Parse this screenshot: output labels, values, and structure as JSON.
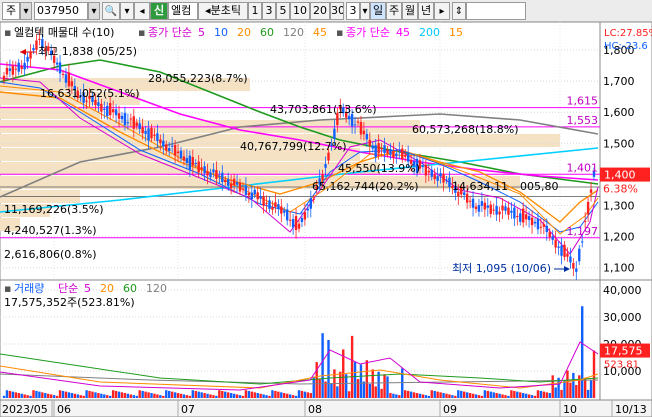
{
  "toolbar": {
    "market": "주",
    "code": "037950",
    "name_tag": "신",
    "name": "엘컴",
    "period_label": "분초틱",
    "periods": [
      "1",
      "3",
      "5",
      "10",
      "20",
      "30"
    ],
    "period_value": "3",
    "tabs": [
      "일",
      "주",
      "월",
      "년"
    ],
    "active_tab": "일"
  },
  "price_pane": {
    "legend_prefix": "엘컴텍 매물대 수(10)",
    "ma_label": "종가 단순",
    "ma_periods": [
      {
        "label": "5",
        "color": "#d100d1"
      },
      {
        "label": "10",
        "color": "#1060ff"
      },
      {
        "label": "20",
        "color": "#ff8c00"
      },
      {
        "label": "60",
        "color": "#1e9a1e"
      },
      {
        "label": "120",
        "color": "#808080"
      },
      {
        "label": "45",
        "color": "#ff8c00"
      }
    ],
    "ma2_label": "종가 단순",
    "ma2_periods": [
      {
        "label": "45",
        "color": "#ff00ff"
      },
      {
        "label": "200",
        "color": "#00c8ff"
      },
      {
        "label": "15",
        "color": "#ff8c00"
      }
    ],
    "lc_label": "LC:27.85%",
    "hc_label": "HC:-23.6",
    "high_label": "최고 1,838 (05/25)",
    "low_label": "최저 1,095 (10/06)",
    "last_price": "1,400",
    "change_pct": "6.38%",
    "h_level_1": "1,615",
    "h_level_2": "1,553",
    "h_level_3": "1,401",
    "h_level_4": "1,197",
    "volume_profile": [
      "28,055,223(8.7%)",
      "16,631,052(5.1%)",
      "43,703,861(13.6%)",
      "60,573,268(18.8%)",
      "40,767,799(12.7%)",
      "45,550(13.9%)",
      "65,162,744(20.2%)",
      "14,634,11",
      "005,80",
      "11,169,226(3.5%)",
      "4,240,527(1.3%)",
      "2,616,806(0.8%)"
    ],
    "y_ticks": [
      "1,800",
      "1,700",
      "1,600",
      "1,500",
      "1,400",
      "1,300",
      "1,200",
      "1,100"
    ]
  },
  "volume_pane": {
    "title": "거래량",
    "ma_label": "단순",
    "ma_periods": [
      {
        "label": "5",
        "color": "#d100d1"
      },
      {
        "label": "20",
        "color": "#ff8c00"
      },
      {
        "label": "60",
        "color": "#1e9a1e"
      },
      {
        "label": "120",
        "color": "#808080"
      }
    ],
    "current": "17,575,352주(523.81%)",
    "last_vol": "17,575",
    "last_pct": "523.81",
    "y_ticks": [
      "40,000",
      "30,000",
      "20,000",
      "10,000"
    ],
    "x_labels": [
      "2023/05",
      "06",
      "07",
      "08",
      "09",
      "10",
      "10/13"
    ]
  },
  "colors": {
    "up": "#ff2020",
    "down": "#1060ff",
    "profile": "#f5e2c5",
    "h_line": "#ff00ff"
  }
}
